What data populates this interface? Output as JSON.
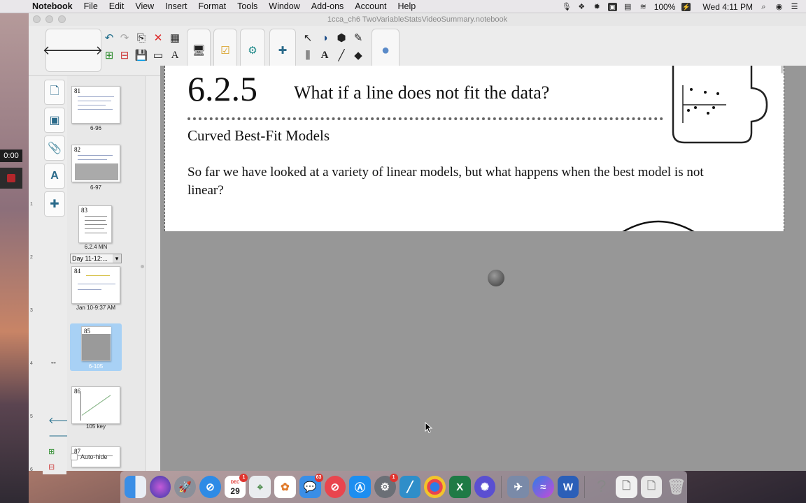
{
  "menubar": {
    "app_name": "Notebook",
    "menus": [
      "File",
      "Edit",
      "View",
      "Insert",
      "Format",
      "Tools",
      "Window",
      "Add-ons",
      "Account",
      "Help"
    ],
    "battery": "100%",
    "clock": "Wed 4:11 PM"
  },
  "recording": {
    "time": "0:00"
  },
  "window": {
    "title": "1cca_ch6 TwoVariableStatsVideoSummary.notebook"
  },
  "sorter": {
    "thumbs": [
      {
        "number": "81",
        "label": "6-96"
      },
      {
        "number": "82",
        "label": "6-97"
      },
      {
        "number": "83",
        "label": "6.2.4 MN"
      },
      {
        "number": "84",
        "label": "Jan 10-9:37 AM"
      },
      {
        "number": "85",
        "label": "6-105"
      },
      {
        "number": "86",
        "label": "105 key"
      },
      {
        "number": "87",
        "label": ""
      }
    ],
    "group_select": "Day 11-12:...",
    "autohide_label": "Auto-hide"
  },
  "ruler_marks": [
    "1",
    "2",
    "3",
    "4",
    "5",
    "6"
  ],
  "page": {
    "lesson_number": "6.2.5",
    "lesson_title": "What if a line does not fit the data?",
    "subtitle": "Curved Best-Fit Models",
    "body": "So far we have looked at a variety of linear models, but what happens when the best model is not linear?"
  },
  "dock": {
    "calendar_month": "DEC",
    "calendar_day": "29",
    "calendar_badge": "1",
    "messages_badge": "63",
    "settings_badge": "1"
  },
  "colors": {
    "accent_teal": "#1f6d8a",
    "selected_thumb": "#a8d1f5",
    "canvas_gray": "#979797"
  }
}
